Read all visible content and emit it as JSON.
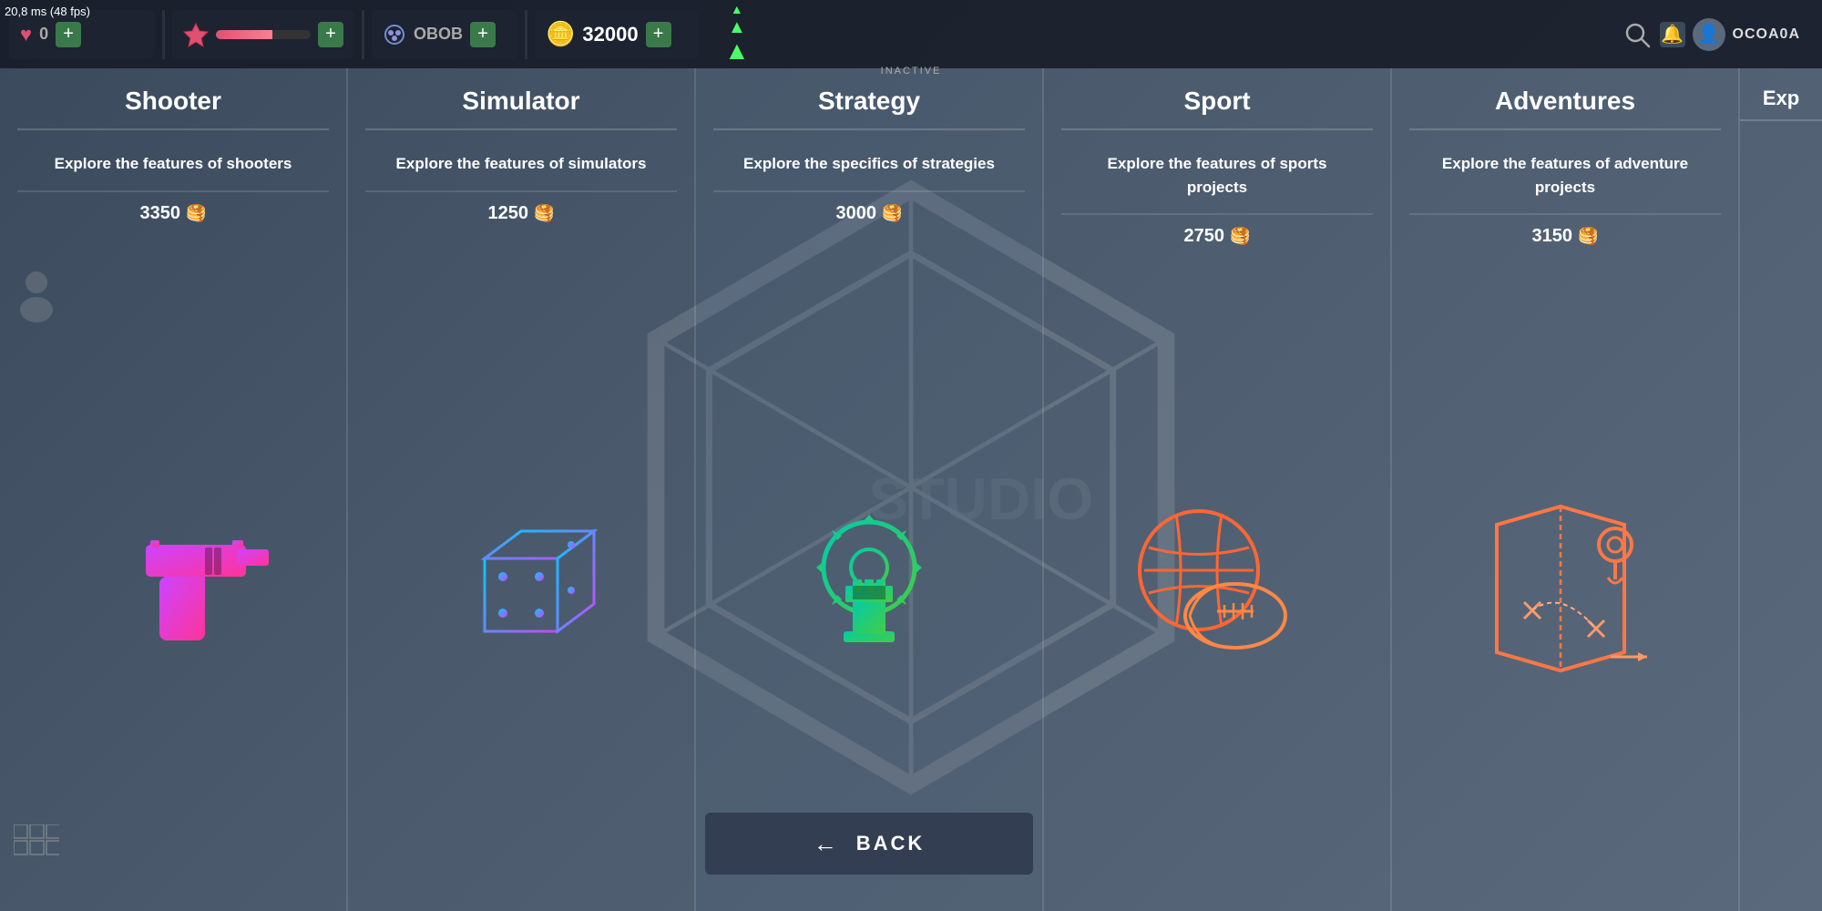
{
  "fps": "20,8 ms (48 fps)",
  "topbar": {
    "lives_value": "0",
    "xp_bar_label": "",
    "orb_label": "OBOB",
    "coin_value": "32000",
    "add_label": "+",
    "inactive_label": "INACTIVE",
    "boost_icon": "⬆⬆",
    "username": "OCOA0A"
  },
  "categories": [
    {
      "id": "shooter",
      "title": "Shooter",
      "description": "Explore the features of shooters",
      "price": "3350",
      "icon": "gun"
    },
    {
      "id": "simulator",
      "title": "Simulator",
      "description": "Explore the features of simulators",
      "price": "1250",
      "icon": "cube"
    },
    {
      "id": "strategy",
      "title": "Strategy",
      "description": "Explore the specifics of strategies",
      "price": "3000",
      "icon": "chess"
    },
    {
      "id": "sport",
      "title": "Sport",
      "description": "Explore the features of sports projects",
      "price": "2750",
      "icon": "ball"
    },
    {
      "id": "adventures",
      "title": "Adventures",
      "description": "Explore the features of adventure projects",
      "price": "3150",
      "icon": "map"
    }
  ],
  "back_button": "BACK",
  "partial_col_description": "Exp"
}
